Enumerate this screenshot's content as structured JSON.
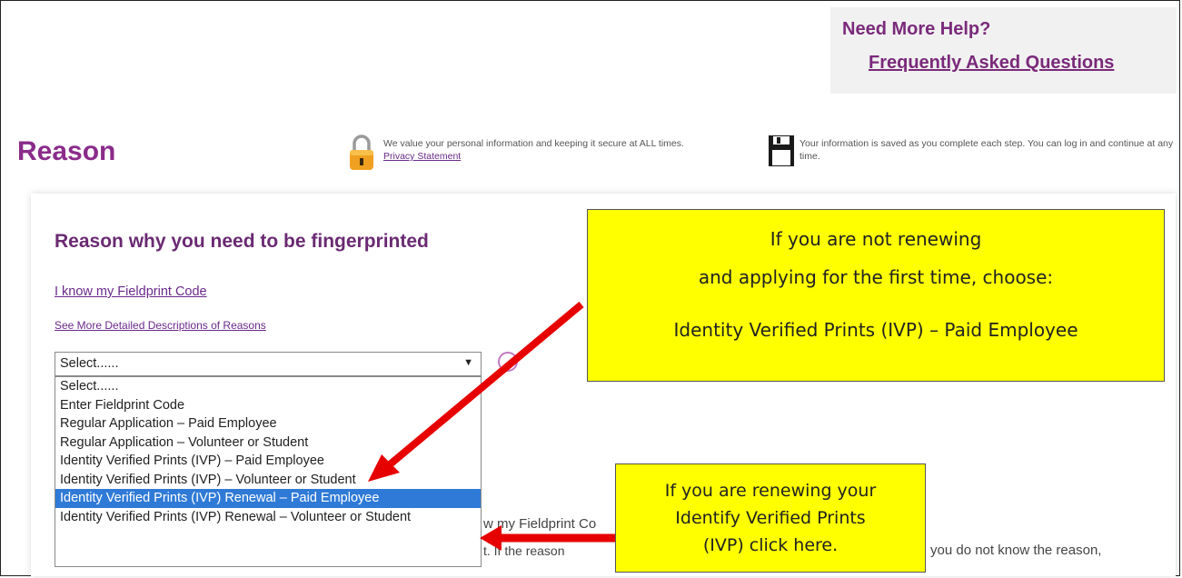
{
  "help": {
    "title": "Need More Help?",
    "faq_link": "Frequently Asked Questions"
  },
  "page": {
    "title": "Reason"
  },
  "notices": {
    "privacy_text": "We value your personal information and keeping it secure at ALL times.",
    "privacy_link": "Privacy Statement",
    "save_text": "Your information is saved as you complete each step. You can log in and continue at any time."
  },
  "form": {
    "section_title": "Reason why you need to be fingerprinted",
    "fieldprint_code_link": "I know my Fieldprint Code",
    "descriptions_link": "See More Detailed Descriptions of Reasons",
    "select_value": "Select......",
    "options": [
      "Select......",
      "Enter Fieldprint Code",
      "Regular Application – Paid Employee",
      "Regular Application – Volunteer or Student",
      "Identity Verified Prints (IVP) – Paid Employee",
      "Identity Verified Prints (IVP) – Volunteer or Student",
      "Identity Verified Prints (IVP) Renewal – Paid Employee",
      "Identity Verified Prints (IVP) Renewal – Volunteer or Student"
    ],
    "selected_option_index": 6,
    "partial_text_1": "w my Fieldprint Co",
    "partial_text_2": "t. If the reason",
    "partial_text_3": "you do not know the reason,"
  },
  "callouts": {
    "first": {
      "line1": "If you are not renewing",
      "line2": "and applying for the first time, choose:",
      "line3": "Identity Verified Prints (IVP) – Paid Employee"
    },
    "second": {
      "line1": "If you are renewing your",
      "line2": "Identify Verified Prints",
      "line3": "(IVP) click here."
    }
  },
  "colors": {
    "accent": "#8a2c8a",
    "callout_bg": "#ffff00",
    "arrow": "#e60000",
    "selected_option": "#2f7ad6"
  }
}
